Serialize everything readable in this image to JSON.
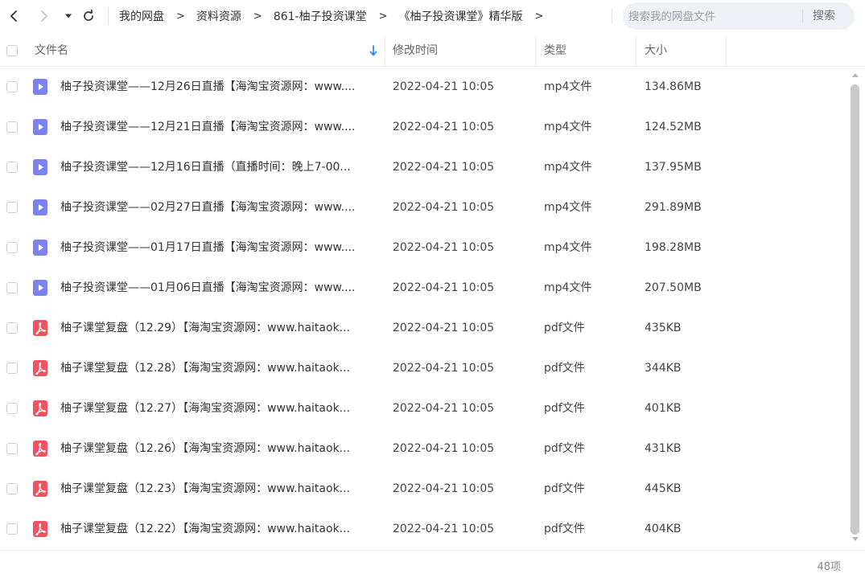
{
  "nav": {
    "breadcrumb": [
      "我的网盘",
      "资料资源",
      "861-柚子投资课堂",
      "《柚子投资课堂》精华版"
    ],
    "separator": ">",
    "search_placeholder": "搜索我的网盘文件",
    "search_button": "搜索"
  },
  "columns": {
    "name": "文件名",
    "modified": "修改时间",
    "type": "类型",
    "size": "大小"
  },
  "files": [
    {
      "name": "柚子投资课堂——12月26日直播【海淘宝资源网：www....",
      "modified": "2022-04-21 10:05",
      "type": "mp4文件",
      "size": "134.86MB",
      "icon": "video-file-icon"
    },
    {
      "name": "柚子投资课堂——12月21日直播【海淘宝资源网：www....",
      "modified": "2022-04-21 10:05",
      "type": "mp4文件",
      "size": "124.52MB",
      "icon": "video-file-icon"
    },
    {
      "name": "柚子投资课堂——12月16日直播（直播时间：晚上7-00...",
      "modified": "2022-04-21 10:05",
      "type": "mp4文件",
      "size": "137.95MB",
      "icon": "video-file-icon"
    },
    {
      "name": "柚子投资课堂——02月27日直播【海淘宝资源网：www....",
      "modified": "2022-04-21 10:05",
      "type": "mp4文件",
      "size": "291.89MB",
      "icon": "video-file-icon"
    },
    {
      "name": "柚子投资课堂——01月17日直播【海淘宝资源网：www....",
      "modified": "2022-04-21 10:05",
      "type": "mp4文件",
      "size": "198.28MB",
      "icon": "video-file-icon"
    },
    {
      "name": "柚子投资课堂——01月06日直播【海淘宝资源网：www....",
      "modified": "2022-04-21 10:05",
      "type": "mp4文件",
      "size": "207.50MB",
      "icon": "video-file-icon"
    },
    {
      "name": "柚子课堂复盘（12.29）【海淘宝资源网：www.haitaok...",
      "modified": "2022-04-21 10:05",
      "type": "pdf文件",
      "size": "435KB",
      "icon": "pdf-file-icon"
    },
    {
      "name": "柚子课堂复盘（12.28）【海淘宝资源网：www.haitaok...",
      "modified": "2022-04-21 10:05",
      "type": "pdf文件",
      "size": "344KB",
      "icon": "pdf-file-icon"
    },
    {
      "name": "柚子课堂复盘（12.27）【海淘宝资源网：www.haitaok...",
      "modified": "2022-04-21 10:05",
      "type": "pdf文件",
      "size": "401KB",
      "icon": "pdf-file-icon"
    },
    {
      "name": "柚子课堂复盘（12.26）【海淘宝资源网：www.haitaok...",
      "modified": "2022-04-21 10:05",
      "type": "pdf文件",
      "size": "431KB",
      "icon": "pdf-file-icon"
    },
    {
      "name": "柚子课堂复盘（12.23）【海淘宝资源网：www.haitaok...",
      "modified": "2022-04-21 10:05",
      "type": "pdf文件",
      "size": "445KB",
      "icon": "pdf-file-icon"
    },
    {
      "name": "柚子课堂复盘（12.22）【海淘宝资源网：www.haitaok...",
      "modified": "2022-04-21 10:05",
      "type": "pdf文件",
      "size": "404KB",
      "icon": "pdf-file-icon"
    }
  ],
  "footer": {
    "count": "48项"
  },
  "colors": {
    "video_icon": "#7b83f0",
    "pdf_icon": "#f0525f",
    "sort_arrow": "#2f8cf5",
    "search_bg": "#eef1f6"
  }
}
